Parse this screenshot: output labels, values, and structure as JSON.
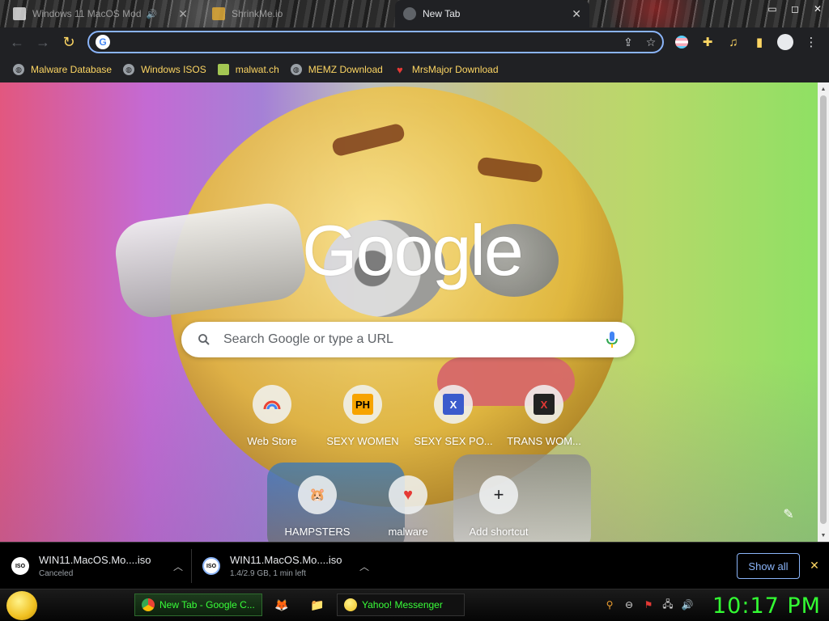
{
  "tabs": [
    {
      "title": "Windows 11 MacOS Mod",
      "active": false
    },
    {
      "title": "ShrinkMe.io",
      "active": false
    },
    {
      "title": "New Tab",
      "active": true
    }
  ],
  "window_controls": {
    "minimize": "▭",
    "maximize": "◻",
    "close": "✕"
  },
  "omnibox": {
    "value": "",
    "placeholder": ""
  },
  "bookmarks": [
    {
      "label": "Malware Database",
      "icon": "globe-icon"
    },
    {
      "label": "Windows ISOS",
      "icon": "globe-icon"
    },
    {
      "label": "malwat.ch",
      "icon": "figure-icon"
    },
    {
      "label": "MEMZ Download",
      "icon": "globe-icon"
    },
    {
      "label": "MrsMajor Download",
      "icon": "heart-icon"
    }
  ],
  "ntp": {
    "logo": "Google",
    "search_placeholder": "Search Google or type a URL",
    "shortcuts": [
      {
        "label": "Web Store",
        "icon": "rainbow-icon"
      },
      {
        "label": "SEXY WOMEN",
        "icon": "PH"
      },
      {
        "label": "SEXY SEX PO...",
        "icon": "X"
      },
      {
        "label": "TRANS WOM...",
        "icon": "X"
      },
      {
        "label": "HAMPSTERS",
        "icon": "hamster-icon"
      },
      {
        "label": "malware",
        "icon": "heart-icon"
      },
      {
        "label": "Add shortcut",
        "icon": "+"
      }
    ]
  },
  "downloads": [
    {
      "name": "WIN11.MacOS.Mo....iso",
      "status": "Canceled",
      "badge": "ISO"
    },
    {
      "name": "WIN11.MacOS.Mo....iso",
      "status": "1.4/2.9 GB, 1 min left",
      "badge": "ISO"
    }
  ],
  "download_shelf": {
    "show_all": "Show all",
    "close": "✕"
  },
  "taskbar": {
    "tasks": [
      {
        "label": "New Tab - Google C...",
        "active": true
      },
      {
        "label": "Yahoo! Messenger",
        "active": false
      }
    ],
    "clock": "10:17 PM"
  },
  "colors": {
    "accent_blue": "#8ab4f8",
    "bookmark_text": "#fdd663",
    "clock_green": "#33ff33",
    "toolbar_bg": "#202124"
  }
}
